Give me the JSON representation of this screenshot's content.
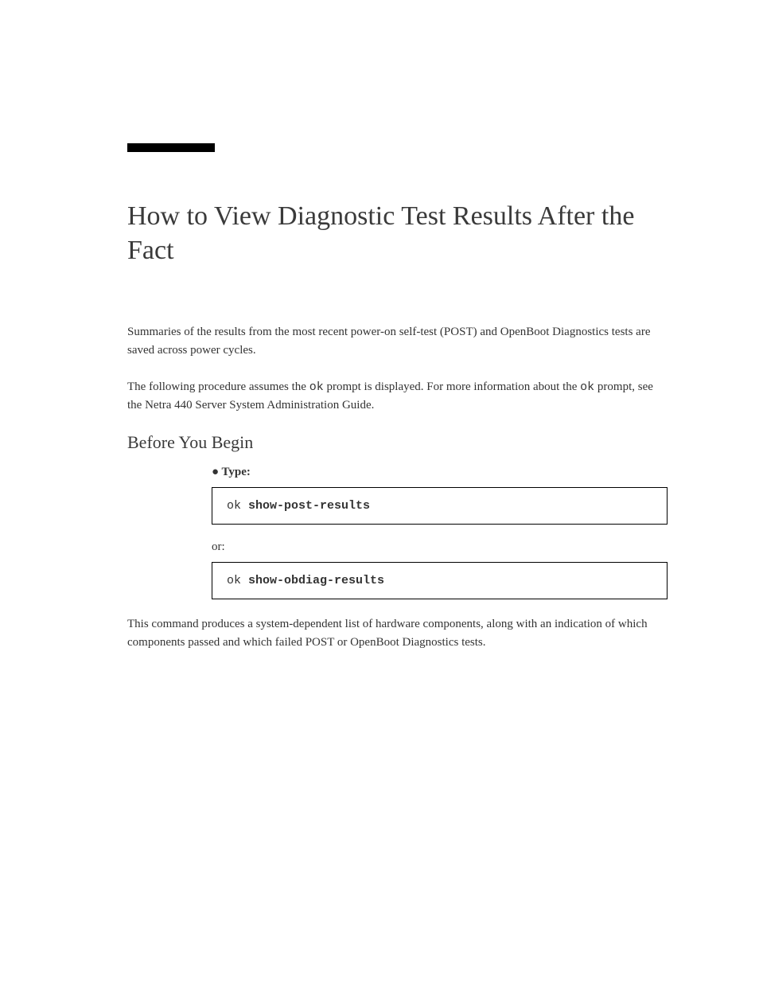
{
  "title": "How to View Diagnostic Test Results After the Fact",
  "intro": {
    "p1_a": "Summaries of the results from the most recent power-on self-test (POST) and OpenBoot Diagnostics tests are saved across power cycles.",
    "p2_a": "The following procedure assumes the ",
    "p2_mono": "ok",
    "p2_b": " prompt is displayed. For more information about the ",
    "p2_mono2": "ok",
    "p2_c": " prompt, see the Netra 440 Server System Administration Guide."
  },
  "before": "Before You Begin",
  "step_label": "● Type:",
  "code1_prompt": "ok ",
  "code1_cmd": "show-post-results",
  "or": "or:",
  "code2_prompt": "ok ",
  "code2_cmd": "show-obdiag-results",
  "result": {
    "p_a": "This command produces a system-dependent list of hardware components, along with an indication of which components passed and which failed POST or OpenBoot Diagnostics tests."
  }
}
